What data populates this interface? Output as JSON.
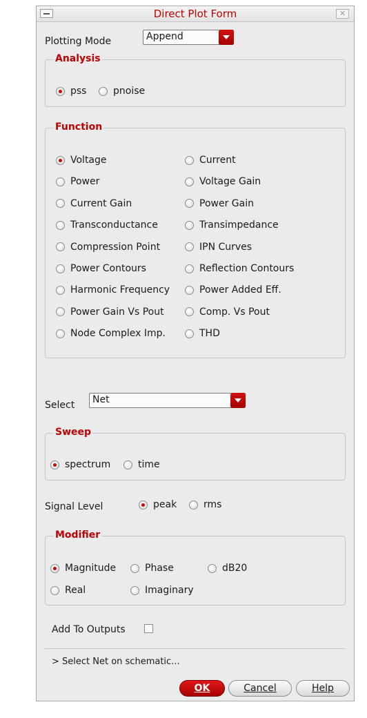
{
  "window": {
    "title": "Direct Plot Form"
  },
  "plotting_mode": {
    "label": "Plotting Mode",
    "value": "Append"
  },
  "analysis": {
    "title": "Analysis",
    "options": [
      {
        "label": "pss",
        "selected": true
      },
      {
        "label": "pnoise",
        "selected": false
      }
    ]
  },
  "function": {
    "title": "Function",
    "left": [
      {
        "label": "Voltage",
        "selected": true
      },
      {
        "label": "Power",
        "selected": false
      },
      {
        "label": "Current Gain",
        "selected": false
      },
      {
        "label": "Transconductance",
        "selected": false
      },
      {
        "label": "Compression Point",
        "selected": false
      },
      {
        "label": "Power Contours",
        "selected": false
      },
      {
        "label": "Harmonic Frequency",
        "selected": false
      },
      {
        "label": "Power Gain Vs Pout",
        "selected": false
      },
      {
        "label": "Node Complex Imp.",
        "selected": false
      }
    ],
    "right": [
      {
        "label": "Current",
        "selected": false
      },
      {
        "label": "Voltage Gain",
        "selected": false
      },
      {
        "label": "Power Gain",
        "selected": false
      },
      {
        "label": "Transimpedance",
        "selected": false
      },
      {
        "label": "IPN Curves",
        "selected": false
      },
      {
        "label": "Reflection Contours",
        "selected": false
      },
      {
        "label": "Power Added Eff.",
        "selected": false
      },
      {
        "label": "Comp. Vs Pout",
        "selected": false
      },
      {
        "label": "THD",
        "selected": false
      }
    ]
  },
  "select": {
    "label": "Select",
    "value": "Net"
  },
  "sweep": {
    "title": "Sweep",
    "options": [
      {
        "label": "spectrum",
        "selected": true
      },
      {
        "label": "time",
        "selected": false
      }
    ]
  },
  "signal_level": {
    "label": "Signal Level",
    "options": [
      {
        "label": "peak",
        "selected": true
      },
      {
        "label": "rms",
        "selected": false
      }
    ]
  },
  "modifier": {
    "title": "Modifier",
    "options": [
      {
        "label": "Magnitude",
        "selected": true
      },
      {
        "label": "Phase",
        "selected": false
      },
      {
        "label": "dB20",
        "selected": false
      },
      {
        "label": "Real",
        "selected": false
      },
      {
        "label": "Imaginary",
        "selected": false
      }
    ]
  },
  "add_to_outputs": {
    "label": "Add To Outputs",
    "checked": false
  },
  "status": {
    "text": "> Select Net on schematic..."
  },
  "buttons": {
    "ok": "OK",
    "cancel": "Cancel",
    "help": "Help"
  },
  "colors": {
    "accent": "#c00000",
    "background": "#ebebeb"
  }
}
